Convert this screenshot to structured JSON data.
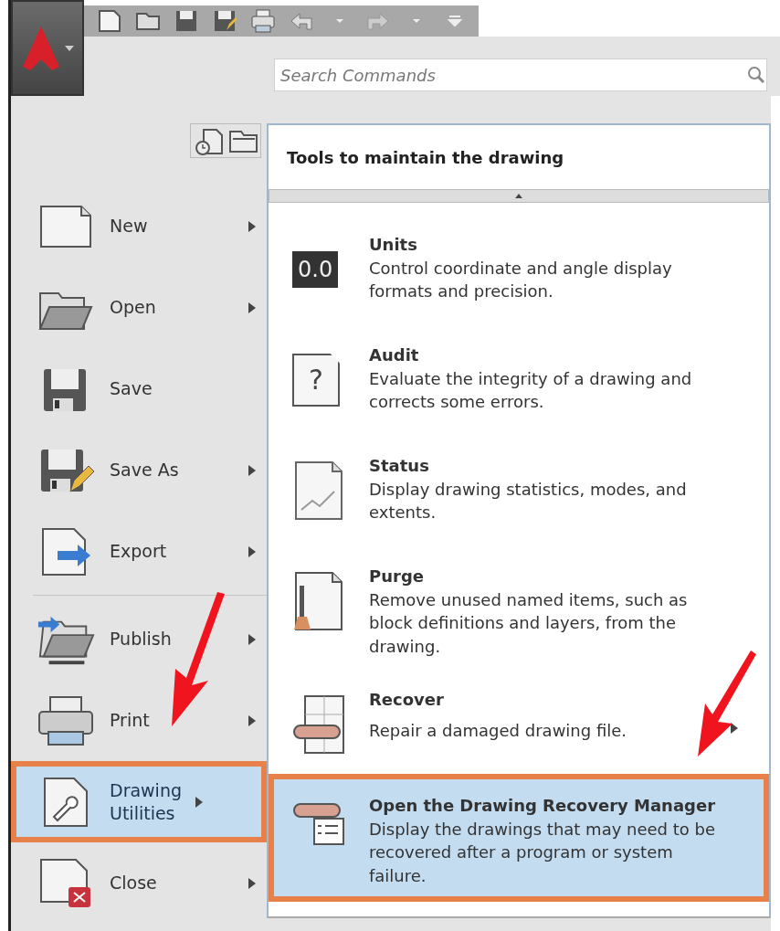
{
  "search": {
    "placeholder": "Search Commands"
  },
  "menu": [
    {
      "label": "New",
      "kind": "new",
      "submenu": true,
      "selected": false
    },
    {
      "label": "Open",
      "kind": "open",
      "submenu": true,
      "selected": false
    },
    {
      "label": "Save",
      "kind": "save",
      "submenu": false,
      "selected": false
    },
    {
      "label": "Save As",
      "kind": "saveas",
      "submenu": true,
      "selected": false
    },
    {
      "label": "Export",
      "kind": "export",
      "submenu": true,
      "selected": false
    },
    {
      "label": "Publish",
      "kind": "publish",
      "submenu": true,
      "selected": false,
      "divider_before": true
    },
    {
      "label": "Print",
      "kind": "print",
      "submenu": true,
      "selected": false
    },
    {
      "label": "Drawing Utilities",
      "kind": "utilities",
      "submenu": true,
      "selected": true
    },
    {
      "label": "Close",
      "kind": "close",
      "submenu": true,
      "selected": false
    }
  ],
  "panel": {
    "title": "Tools to maintain the drawing",
    "items": [
      {
        "title": "Units",
        "description": "Control coordinate and angle display formats and precision.",
        "kind": "units",
        "icon_text": "0.0",
        "submenu": false,
        "selected": false
      },
      {
        "title": "Audit",
        "description": "Evaluate the integrity of a drawing and corrects some errors.",
        "kind": "audit",
        "icon_text": "?",
        "submenu": false,
        "selected": false
      },
      {
        "title": "Status",
        "description": "Display drawing statistics, modes, and extents.",
        "kind": "status",
        "submenu": false,
        "selected": false
      },
      {
        "title": "Purge",
        "description": "Remove unused named items, such as block definitions and layers, from the drawing.",
        "kind": "purge",
        "submenu": false,
        "selected": false
      },
      {
        "title": "Recover",
        "description": "Repair a damaged drawing file.",
        "kind": "recover",
        "submenu": true,
        "selected": false
      },
      {
        "title": "Open the Drawing Recovery Manager",
        "description": "Display the drawings that may need to be recovered after a program or system failure.",
        "kind": "manager",
        "submenu": false,
        "selected": true
      }
    ]
  }
}
